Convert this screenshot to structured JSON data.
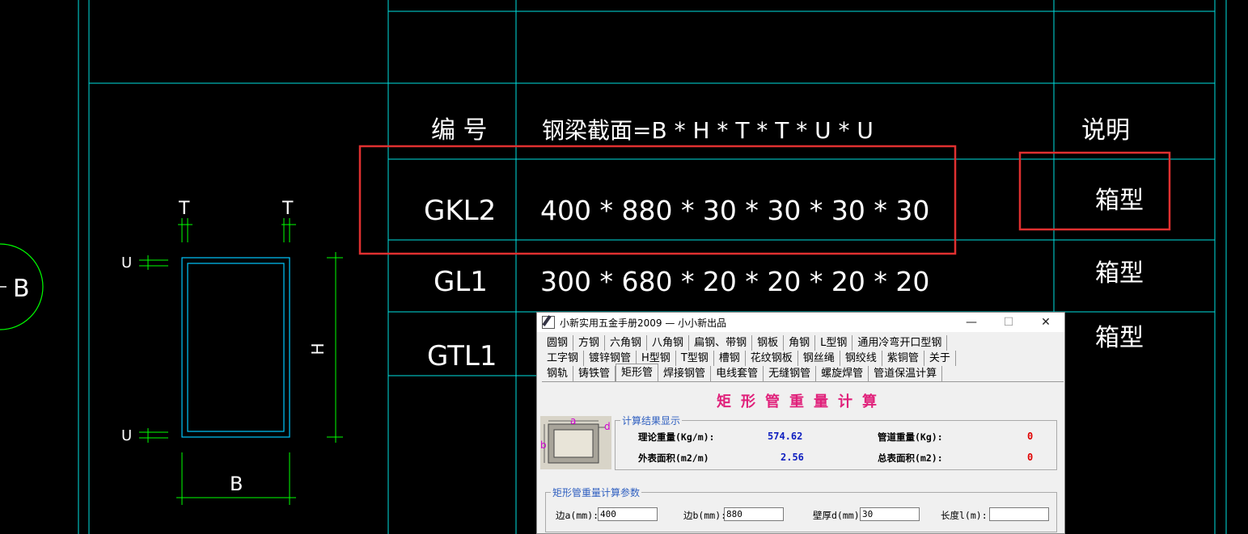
{
  "drawing": {
    "axis_label": "B",
    "table": {
      "header": {
        "id": "编 号",
        "section": "钢梁截面=B * H * T * T * U * U",
        "note": "说明"
      },
      "rows": [
        {
          "id": "GKL2",
          "section": "400 * 880 * 30 * 30 * 30 * 30",
          "note": "箱型"
        },
        {
          "id": "GL1",
          "section": "300 * 680 * 20 * 20 * 20 * 20",
          "note": "箱型"
        },
        {
          "id": "GTL1",
          "section": "",
          "note": "箱型"
        }
      ]
    },
    "section_sketch": {
      "t_left": "T",
      "t_right": "T",
      "u_top": "U",
      "u_bottom": "U",
      "h_label": "H",
      "b_label": "B"
    },
    "colors": {
      "grid": "#00e0e0",
      "dim": "#00ff00",
      "highlight": "#e03030",
      "circle": "#00ff00"
    }
  },
  "dialog": {
    "title": "小新实用五金手册2009 — 小小新出品",
    "controls": {
      "minimize": "—",
      "maximize": "☐",
      "close": "✕"
    },
    "tabs_row1": [
      "圆钢",
      "方钢",
      "六角钢",
      "八角钢",
      "扁钢、带钢",
      "钢板",
      "角钢",
      "L型钢",
      "通用冷弯开口型钢"
    ],
    "tabs_row2": [
      "工字钢",
      "镀锌钢管",
      "H型钢",
      "T型钢",
      "槽钢",
      "花纹钢板",
      "钢丝绳",
      "钢绞线",
      "紫铜管",
      "关于"
    ],
    "tabs_row3": [
      "钢轨",
      "铸铁管",
      "矩形管",
      "焊接钢管",
      "电线套管",
      "无缝钢管",
      "螺旋焊管",
      "管道保温计算"
    ],
    "active_tab": "矩形管",
    "heading": "矩形管重量计算",
    "diagram_labels": {
      "a": "a",
      "b": "b",
      "d": "d"
    },
    "results": {
      "legend": "计算结果显示",
      "theory_weight_label": "理论重量(Kg/m):",
      "theory_weight_value": "574.62",
      "pipe_weight_label": "管道重量(Kg):",
      "pipe_weight_value": "0",
      "outer_area_label": "外表面积(m2/m)",
      "outer_area_value": "2.56",
      "total_area_label": "总表面积(m2):",
      "total_area_value": "0"
    },
    "params": {
      "legend": "矩形管重量计算参数",
      "side_a_label": "边a(mm):",
      "side_a_value": "400",
      "side_b_label": "边b(mm):",
      "side_b_value": "880",
      "wall_label": "壁厚d(mm)",
      "wall_value": "30",
      "length_label": "长度l(m):",
      "length_value": ""
    }
  }
}
